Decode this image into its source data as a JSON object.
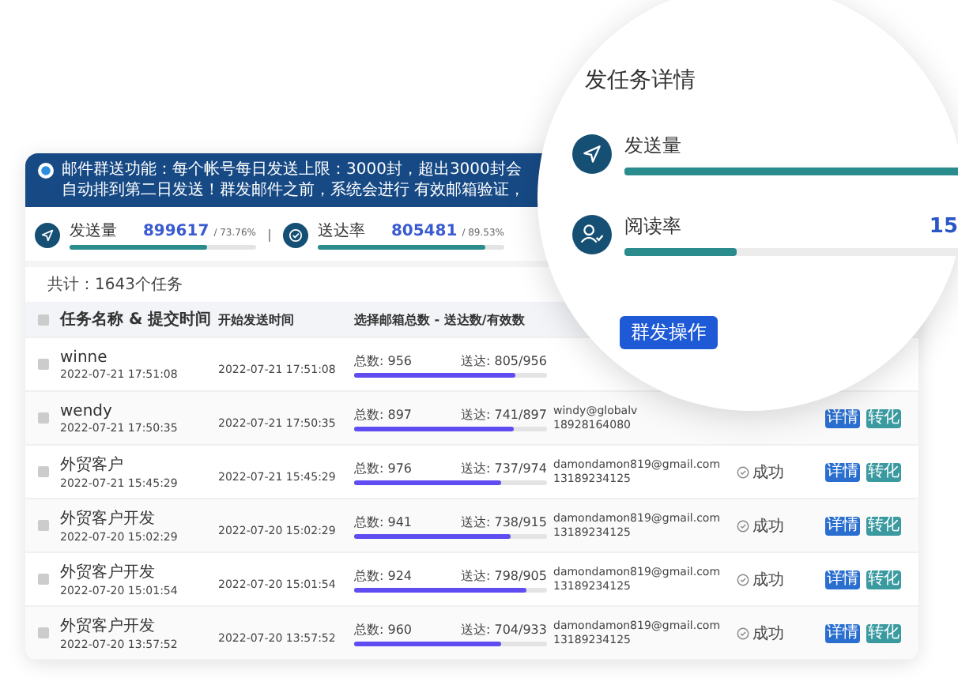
{
  "notice": {
    "text": "邮件群送功能：每个帐号每日发送上限：3000封，超出3000封会自动排到第二日发送！群发邮件之前，系统会进行 有效邮箱验证，"
  },
  "stats": [
    {
      "kind": "send",
      "label": "发送量",
      "value": "899617",
      "percent": "/ 73.76%",
      "level": 0.74
    },
    {
      "kind": "delivered",
      "label": "送达率",
      "value": "805481",
      "percent": "/ 89.53%",
      "level": 0.9
    }
  ],
  "total": "共计：1643个任务",
  "table": {
    "all_checked": false,
    "columns": [
      "任务名称 & 提交时间",
      "开始发送时间",
      "选择邮箱总数 - 送达数/有效数"
    ],
    "rows": [
      {
        "checked": false,
        "name": "winne",
        "submitted": "2022-07-21 17:51:08",
        "start": "2022-07-21 17:51:08",
        "total": "总数: 956",
        "delivered": "送达: 805/956",
        "level": 0.84
      },
      {
        "checked": false,
        "name": "wendy",
        "submitted": "2022-07-21 17:50:35",
        "start": "2022-07-21 17:50:35",
        "total": "总数: 897",
        "delivered": "送达: 741/897",
        "level": 0.83,
        "email": "windy@globalv",
        "phone": "18928164080",
        "actions": [
          "详情",
          "转化"
        ]
      },
      {
        "checked": false,
        "name": "外贸客户",
        "submitted": "2022-07-21 15:45:29",
        "start": "2022-07-21 15:45:29",
        "total": "总数: 976",
        "delivered": "送达: 737/974",
        "level": 0.76,
        "email": "damondamon819@gmail.com",
        "phone": "13189234125",
        "status": "成功",
        "actions": [
          "详情",
          "转化"
        ]
      },
      {
        "checked": false,
        "name": "外贸客户开发",
        "submitted": "2022-07-20 15:02:29",
        "start": "2022-07-20 15:02:29",
        "total": "总数: 941",
        "delivered": "送达: 738/915",
        "level": 0.81,
        "email": "damondamon819@gmail.com",
        "phone": "13189234125",
        "status": "成功",
        "actions": [
          "详情",
          "转化"
        ]
      },
      {
        "checked": false,
        "name": "外贸客户开发",
        "submitted": "2022-07-20 15:01:54",
        "start": "2022-07-20 15:01:54",
        "total": "总数: 924",
        "delivered": "送达: 798/905",
        "level": 0.89,
        "email": "damondamon819@gmail.com",
        "phone": "13189234125",
        "status": "成功",
        "actions": [
          "详情",
          "转化"
        ]
      },
      {
        "checked": false,
        "name": "外贸客户开发",
        "submitted": "2022-07-20 13:57:52",
        "start": "2022-07-20 13:57:52",
        "total": "总数: 960",
        "delivered": "送达: 704/933",
        "level": 0.76,
        "email": "damondamon819@gmail.com",
        "phone": "13189234125",
        "status": "成功",
        "actions": [
          "详情",
          "转化"
        ]
      }
    ]
  },
  "magnifier": {
    "title": "发任务详情",
    "metrics": [
      {
        "kind": "send",
        "label": "发送量",
        "level": 1
      },
      {
        "kind": "read",
        "label": "阅读率",
        "value": "15",
        "level": 0.33
      }
    ],
    "buttons": [
      "群发操作"
    ]
  }
}
